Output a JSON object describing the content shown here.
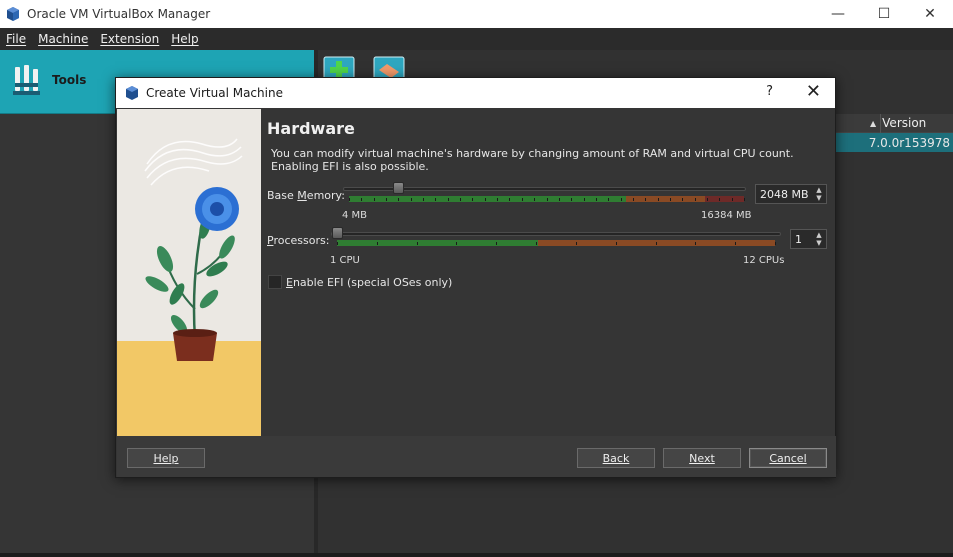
{
  "window": {
    "title": "Oracle VM VirtualBox Manager",
    "minimize": "—",
    "maximize": "☐",
    "close": "✕"
  },
  "menu": [
    {
      "label": "File"
    },
    {
      "label": "Machine"
    },
    {
      "label": "Extension"
    },
    {
      "label": "Help"
    }
  ],
  "tools": {
    "label": "Tools"
  },
  "table": {
    "column_header": "Version",
    "row_value": "7.0.0r153978"
  },
  "dialog": {
    "title": "Create Virtual Machine",
    "help_glyph": "?",
    "close_glyph": "✕",
    "heading": "Hardware",
    "description_line1": "You can modify virtual machine's hardware by changing amount of RAM and virtual CPU count.",
    "description_line2": "Enabling EFI is also possible.",
    "memory": {
      "label": "Base Memory:",
      "value": 2048,
      "value_text": "2048 MB",
      "min_label": "4 MB",
      "max_label": "16384 MB",
      "min": 4,
      "max": 16384
    },
    "processors": {
      "label": "Processors:",
      "value": 1,
      "value_text": "1",
      "min_label": "1 CPU",
      "max_label": "12 CPUs",
      "min": 1,
      "max": 12
    },
    "efi": {
      "label": "Enable EFI (special OSes only)",
      "checked": false
    },
    "buttons": {
      "help": "Help",
      "back": "Back",
      "next": "Next",
      "cancel": "Cancel"
    }
  },
  "colors": {
    "accent": "#1ea4b4",
    "zone_green": "#2f7d32",
    "zone_orange": "#8a4a24",
    "zone_red": "#6e2a28"
  }
}
